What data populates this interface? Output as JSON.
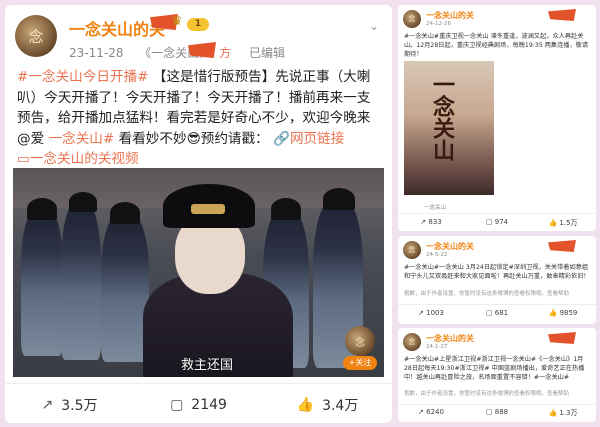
{
  "main": {
    "author": "一念关山的关",
    "level": "1",
    "date": "23-11-28",
    "source": "《一念关山》",
    "source_suffix": "方",
    "edited": "已编辑",
    "post": {
      "hashtag": "#一念关山今日开播#",
      "body": "【这是惜行版预告】先说正事（大喇叭）今天开播了！今天开播了！今天开播了！播前再来一支预告，给开播加点猛料！看完若是好奇心不少，欢迎今晚来@爱",
      "tag2": "一念关山#",
      "body2": "看看妙不妙",
      "emoji": "😎",
      "body3": "预约请戳：",
      "link": "网页链接",
      "video_prefix": "一念关山的关",
      "video_suffix": "视频"
    },
    "video_subtitle": "救主还国",
    "follow": "+关注",
    "shares": "3.5万",
    "comments": "2149",
    "likes": "3.4万"
  },
  "right": [
    {
      "author": "一念关山的关",
      "date": "24-12-26",
      "text": "#一念关山#重庆卫视一念关山 凛冬重逢，波澜又起，众人再赴关山。12月28日起，重庆卫视经典剧场，每晚19:35 两集连播，敬请期待！",
      "poster_title": "一念关山",
      "poster_caption": "一念关山",
      "shares": "833",
      "comments": "974",
      "likes": "1.5万"
    },
    {
      "author": "一念关山的关",
      "date": "24-5-22",
      "text": "#一念关山#一念关山 3月24日起锁定#深圳卫视，关关带着如意姐和宁头儿又双叒赶来和大家见面啦！再赴关山万重，敢奉精彩依旧！",
      "note": "抱歉，由于作者设置，你暂时没有这条微博的查看权限哦。查看帮助",
      "shares": "1003",
      "comments": "681",
      "likes": "9859"
    },
    {
      "author": "一念关山的关",
      "date": "24-1-27",
      "text": "#一念关山#上星浙江卫视#浙江卫视一念关山#《一念关山》1月28日起每天19:30#浙江卫视# 中国蓝剧场播出，爱奇艺正在热播中！越关山再赴冒险之旅，名场面重置不容错！#一念关山#",
      "note": "抱歉，由于作者设置，你暂时没有这条微博的查看权限哦。查看帮助",
      "shares": "6240",
      "comments": "888",
      "likes": "1.3万"
    }
  ],
  "icons": {
    "share": "share-icon",
    "comment": "comment-icon",
    "like": "like-icon"
  },
  "colors": {
    "accent": "#eb7350",
    "name": "#f08210",
    "background": "#f1e0ee"
  }
}
